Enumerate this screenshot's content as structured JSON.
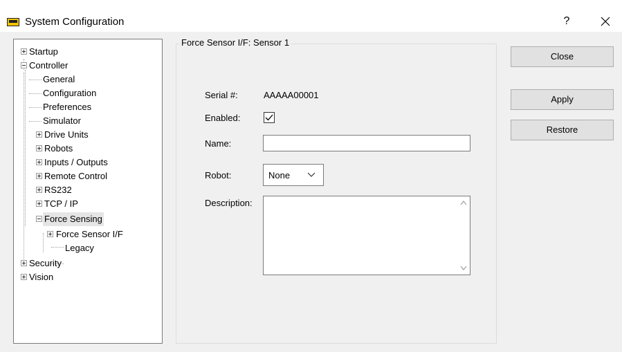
{
  "window": {
    "title": "System Configuration",
    "help_label": "?",
    "icon": "monitor-app-icon",
    "close_icon": "close-icon"
  },
  "tree": {
    "items": [
      {
        "label": "Startup",
        "expander": "plus"
      },
      {
        "label": "Controller",
        "expander": "minus"
      },
      {
        "label": "General"
      },
      {
        "label": "Configuration"
      },
      {
        "label": "Preferences"
      },
      {
        "label": "Simulator"
      },
      {
        "label": "Drive Units",
        "expander": "plus"
      },
      {
        "label": "Robots",
        "expander": "plus"
      },
      {
        "label": "Inputs / Outputs",
        "expander": "plus"
      },
      {
        "label": "Remote Control",
        "expander": "plus"
      },
      {
        "label": "RS232",
        "expander": "plus"
      },
      {
        "label": "TCP / IP",
        "expander": "plus"
      },
      {
        "label": "Force Sensing",
        "expander": "minus",
        "selected": true
      },
      {
        "label": "Force Sensor I/F",
        "expander": "plus"
      },
      {
        "label": "Legacy"
      },
      {
        "label": "Security",
        "expander": "plus"
      },
      {
        "label": "Vision",
        "expander": "plus"
      }
    ]
  },
  "panel": {
    "group_title": "Force Sensor I/F: Sensor 1",
    "serial_label": "Serial #:",
    "serial_value": "AAAAA00001",
    "enabled_label": "Enabled:",
    "enabled": true,
    "name_label": "Name:",
    "name_value": "",
    "robot_label": "Robot:",
    "robot_value": "None",
    "description_label": "Description:",
    "description_value": ""
  },
  "buttons": {
    "close": "Close",
    "apply": "Apply",
    "restore": "Restore"
  }
}
